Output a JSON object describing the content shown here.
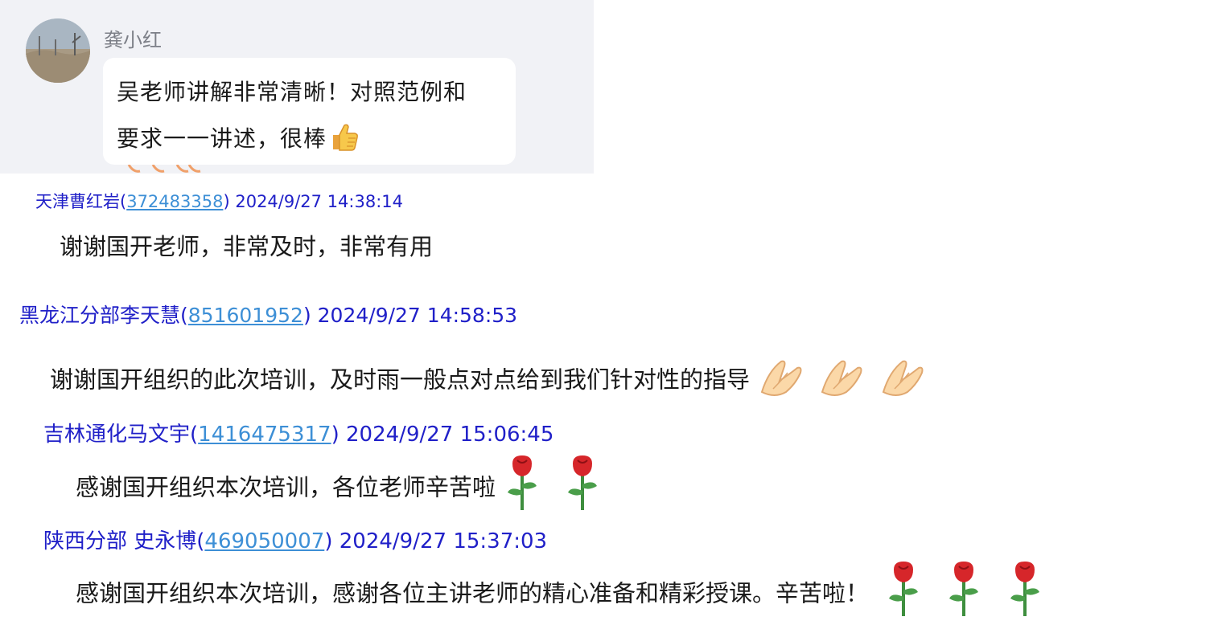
{
  "top_message": {
    "sender": "龚小红",
    "text_line1": "吴老师讲解非常清晰！对照范例和",
    "text_line2": "要求一一讲述，很棒",
    "emoji": "thumbs-up-icon"
  },
  "messages": [
    {
      "name": "天津曹红岩",
      "qq": "372483358",
      "time": "2024/9/27 14:38:14",
      "text": "谢谢国开老师，非常及时，非常有用"
    },
    {
      "name": "黑龙江分部李天慧",
      "qq": "851601952",
      "time": "2024/9/27 14:58:53",
      "text": "谢谢国开组织的此次培训，及时雨一般点对点给到我们针对性的指导",
      "emoji": "praying-hands-icon",
      "emoji_count": 3
    },
    {
      "name": "吉林通化马文宇",
      "qq": "1416475317",
      "time": "2024/9/27 15:06:45",
      "text": "感谢国开组织本次培训，各位老师辛苦啦",
      "emoji": "rose-icon",
      "emoji_count": 2
    },
    {
      "name": "陕西分部 史永博",
      "qq": "469050007",
      "time": "2024/9/27 15:37:03",
      "text": "感谢国开组织本次培训，感谢各位主讲老师的精心准备和精彩授课。辛苦啦！",
      "emoji": "rose-icon",
      "emoji_count": 3
    }
  ],
  "punct": {
    "open": "(",
    "close": ")"
  },
  "colors": {
    "name": "#2020c8",
    "qq_link": "#3d8fd6",
    "card_bg": "#f1f2f6"
  }
}
